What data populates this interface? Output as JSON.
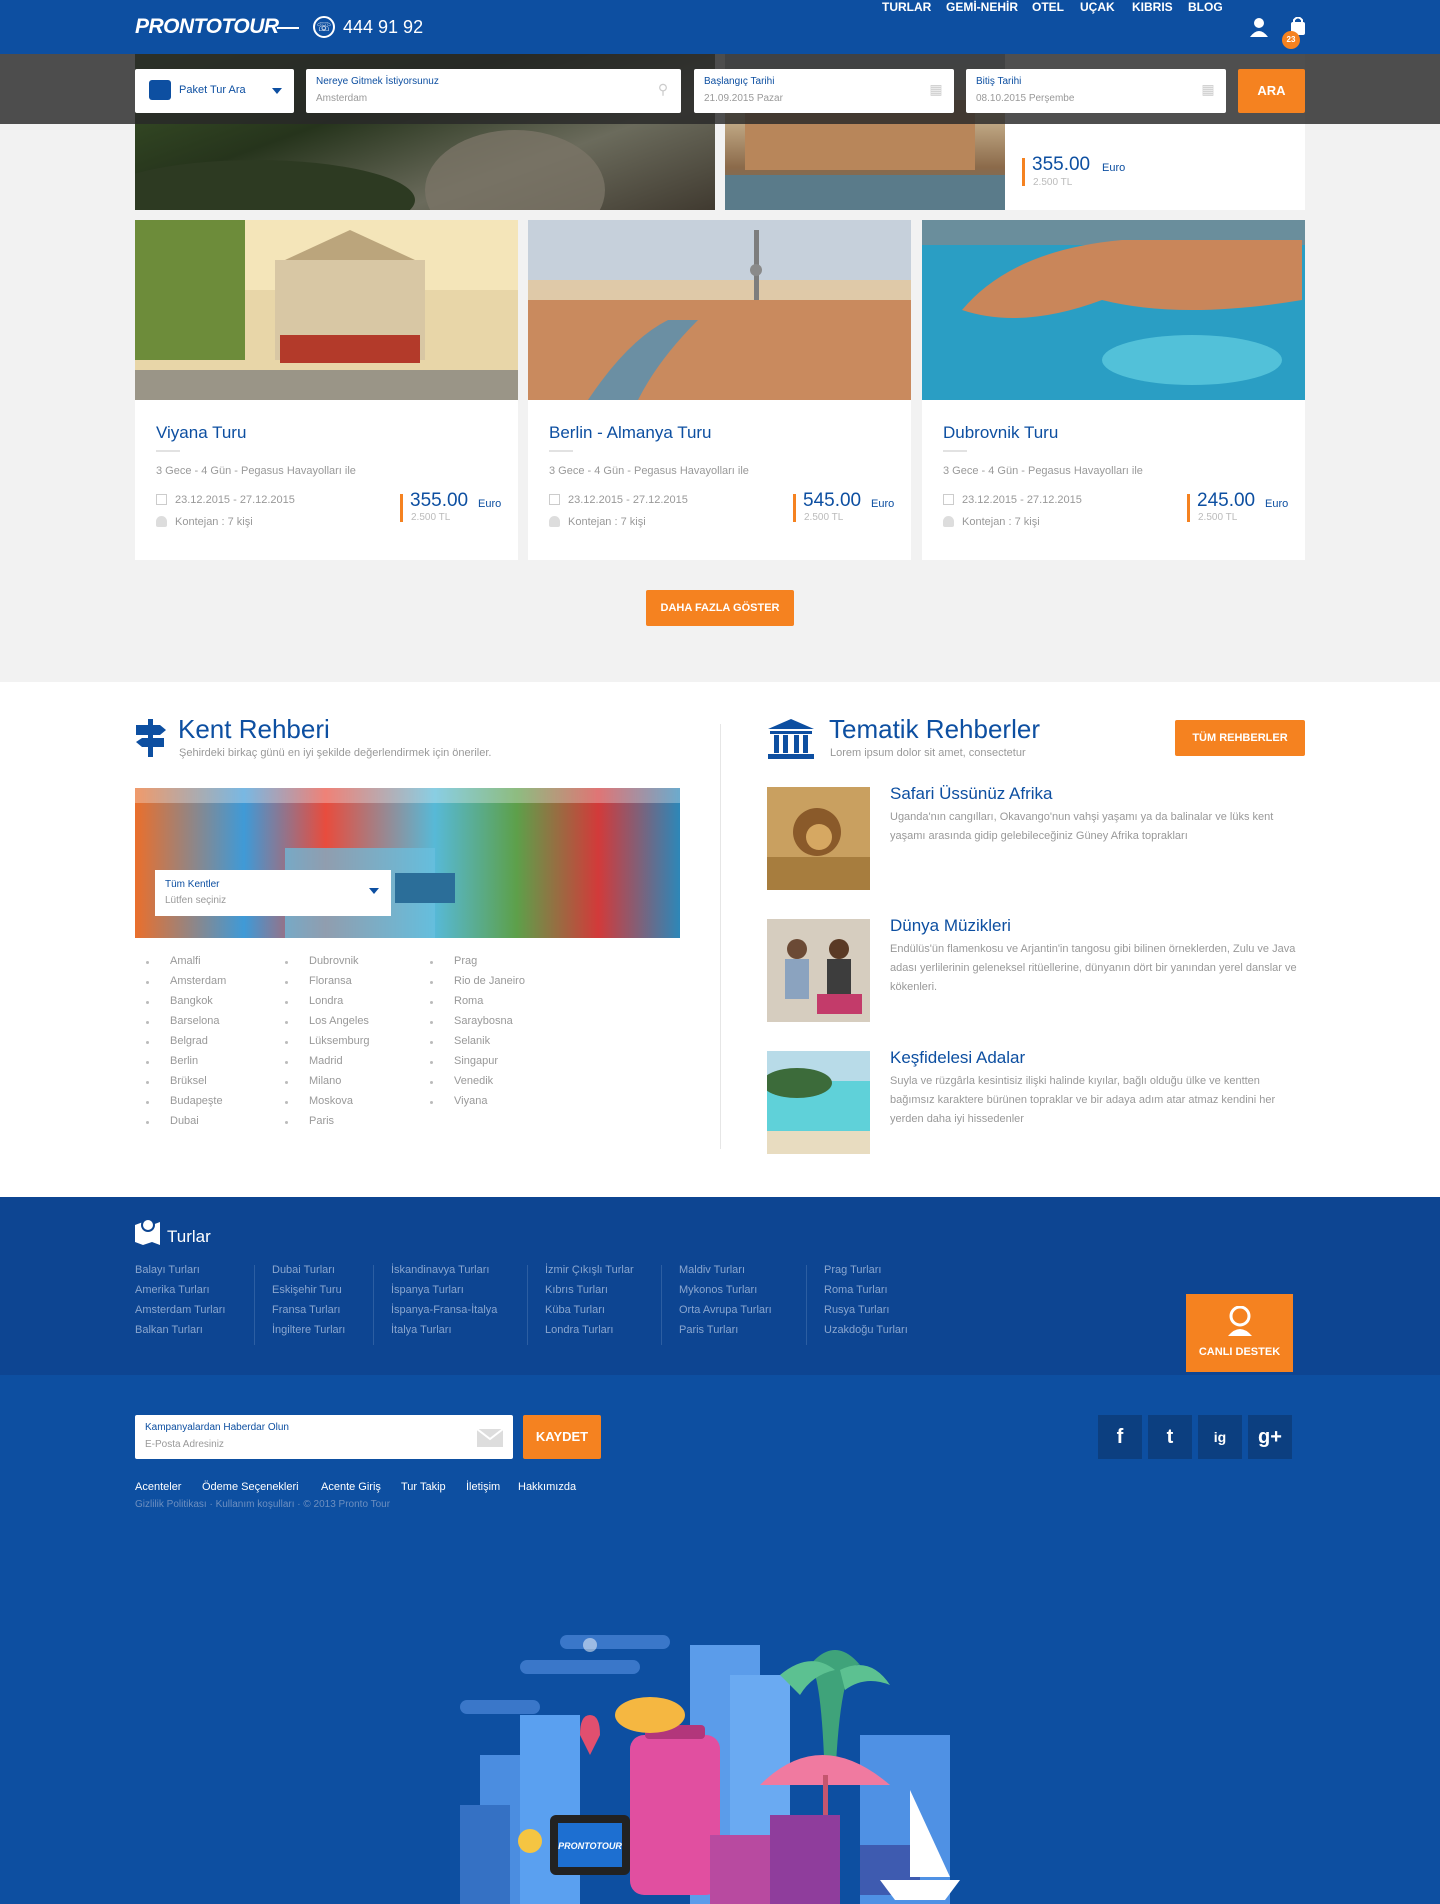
{
  "header": {
    "logo": "PRONTOTOUR",
    "phone": "444 91 92",
    "nav": [
      "TURLAR",
      "GEMİ-NEHİR",
      "OTEL",
      "UÇAK",
      "KIBRIS",
      "BLOG"
    ],
    "cart_count": "23"
  },
  "search": {
    "type_label": "Paket Tur Ara",
    "destination_label": "Nereye Gitmek İstiyorsunuz",
    "destination_value": "Amsterdam",
    "start_label": "Başlangıç Tarihi",
    "start_value": "21.09.2015 Pazar",
    "end_label": "Bitiş Tarihi",
    "end_value": "08.10.2015 Perşembe",
    "button": "ARA"
  },
  "featured": {
    "price": "355.00",
    "currency": "Euro",
    "price_tl": "2.500 TL"
  },
  "tours": [
    {
      "title": "Viyana Turu",
      "subtitle": "3 Gece - 4 Gün - Pegasus Havayolları ile",
      "dates": "23.12.2015 - 27.12.2015",
      "capacity": "Kontejan : 7 kişi",
      "price": "355.00",
      "currency": "Euro",
      "price_tl": "2.500 TL"
    },
    {
      "title": "Berlin - Almanya Turu",
      "subtitle": "3 Gece - 4 Gün - Pegasus Havayolları ile",
      "dates": "23.12.2015 - 27.12.2015",
      "capacity": "Kontejan : 7 kişi",
      "price": "545.00",
      "currency": "Euro",
      "price_tl": "2.500 TL"
    },
    {
      "title": "Dubrovnik Turu",
      "subtitle": "3 Gece - 4 Gün - Pegasus Havayolları ile",
      "dates": "23.12.2015 - 27.12.2015",
      "capacity": "Kontejan : 7 kişi",
      "price": "245.00",
      "currency": "Euro",
      "price_tl": "2.500 TL"
    }
  ],
  "more_button": "DAHA FAZLA GÖSTER",
  "city_guide": {
    "title": "Kent Rehberi",
    "subtitle": "Şehirdeki birkaç günü en iyi şekilde değerlendirmek için öneriler.",
    "select_label": "Tüm Kentler",
    "select_placeholder": "Lütfen seçiniz",
    "cities_col1": [
      "Amalfi",
      "Amsterdam",
      "Bangkok",
      "Barselona",
      "Belgrad",
      "Berlin",
      "Brüksel",
      "Budapeşte",
      "Dubai"
    ],
    "cities_col2": [
      "Dubrovnik",
      "Floransa",
      "Londra",
      "Los Angeles",
      "Lüksemburg",
      "Madrid",
      "Milano",
      "Moskova",
      "Paris"
    ],
    "cities_col3": [
      "Prag",
      "Rio de Janeiro",
      "Roma",
      "Saraybosna",
      "Selanik",
      "Singapur",
      "Venedik",
      "Viyana"
    ]
  },
  "thematic": {
    "title": "Tematik Rehberler",
    "subtitle": "Lorem ipsum dolor sit amet, consectetur",
    "button": "TÜM REHBERLER",
    "items": [
      {
        "title": "Safari Üssünüz Afrika",
        "desc": "Uganda'nın cangılları, Okavango'nun vahşi yaşamı ya da balinalar ve lüks kent yaşamı arasında gidip gelebileceğiniz Güney Afrika toprakları"
      },
      {
        "title": "Dünya Müzikleri",
        "desc": "Endülüs'ün flamenkosu ve Arjantin'in tangosu gibi bilinen örneklerden, Zulu ve Java adası yerlilerinin geleneksel ritüellerine, dünyanın dört bir yanından yerel danslar ve kökenleri."
      },
      {
        "title": "Keşfidelesi Adalar",
        "desc": "Suyla ve rüzgârla kesintisiz ilişki halinde kıyılar, bağlı olduğu ülke ve kentten bağımsız karaktere bürünen topraklar ve bir adaya adım atar atmaz kendini her yerden daha iyi hissedenler"
      }
    ]
  },
  "footer": {
    "tours_title": "Turlar",
    "tour_columns": [
      [
        "Balayı Turları",
        "Amerika Turları",
        "Amsterdam Turları",
        "Balkan Turları"
      ],
      [
        "Dubai Turları",
        "Eskişehir Turu",
        "Fransa Turları",
        "İngiltere Turları"
      ],
      [
        "İskandinavya Turları",
        "İspanya Turları",
        "İspanya-Fransa-İtalya",
        "İtalya Turları"
      ],
      [
        "İzmir Çıkışlı Turlar",
        "Kıbrıs Turları",
        "Küba Turları",
        "Londra Turları"
      ],
      [
        "Maldiv Turları",
        "Mykonos Turları",
        "Orta Avrupa Turları",
        "Paris Turları"
      ],
      [
        "Prag Turları",
        "Roma Turları",
        "Rusya Turları",
        "Uzakdoğu Turları"
      ]
    ],
    "support": "CANLI DESTEK",
    "newsletter_label": "Kampanyalardan Haberdar Olun",
    "newsletter_placeholder": "E-Posta Adresiniz",
    "newsletter_button": "KAYDET",
    "social": [
      "f",
      "t",
      "ig",
      "g+"
    ],
    "links": [
      "Acenteler",
      "Ödeme Seçenekleri",
      "Acente Giriş",
      "Tur Takip",
      "İletişim",
      "Hakkımızda"
    ],
    "legal": "Gizlilik Politikası · Kullanım koşulları · © 2013 Pronto Tour",
    "illustration_logo": "PRONTOTOUR"
  },
  "colors": {
    "brand": "#0d4fa1",
    "accent": "#f58220"
  }
}
